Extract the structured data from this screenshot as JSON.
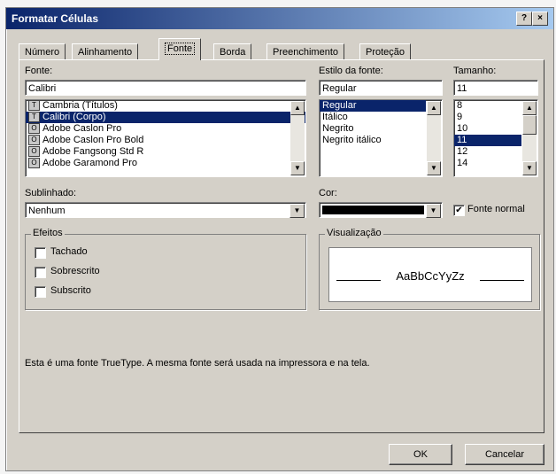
{
  "title": "Formatar Células",
  "title_buttons": {
    "help": "?",
    "close": "×"
  },
  "tabs": [
    {
      "label": "Número"
    },
    {
      "label": "Alinhamento"
    },
    {
      "label": "Fonte"
    },
    {
      "label": "Borda"
    },
    {
      "label": "Preenchimento"
    },
    {
      "label": "Proteção"
    }
  ],
  "active_tab": "Fonte",
  "font": {
    "label": "Fonte:",
    "value": "Calibri",
    "items": [
      "Cambria (Títulos)",
      "Calibri (Corpo)",
      "Adobe Caslon Pro",
      "Adobe Caslon Pro Bold",
      "Adobe Fangsong Std R",
      "Adobe Garamond Pro"
    ],
    "selected": "Calibri (Corpo)"
  },
  "style": {
    "label": "Estilo da fonte:",
    "value": "Regular",
    "items": [
      "Regular",
      "Itálico",
      "Negrito",
      "Negrito itálico"
    ],
    "selected": "Regular"
  },
  "size": {
    "label": "Tamanho:",
    "value": "11",
    "items": [
      "8",
      "9",
      "10",
      "11",
      "12",
      "14"
    ],
    "selected": "11"
  },
  "underline": {
    "label": "Sublinhado:",
    "value": "Nenhum"
  },
  "color": {
    "label": "Cor:",
    "value": "#000000"
  },
  "normal_font": {
    "label": "Fonte normal",
    "checked": true
  },
  "effects": {
    "title": "Efeitos",
    "items": [
      {
        "label": "Tachado",
        "checked": false
      },
      {
        "label": "Sobrescrito",
        "checked": false
      },
      {
        "label": "Subscrito",
        "checked": false
      }
    ]
  },
  "preview": {
    "title": "Visualização",
    "sample": "AaBbCcYyZz"
  },
  "info_text": "Esta é uma fonte TrueType. A mesma fonte será usada na impressora e na tela.",
  "buttons": {
    "ok": "OK",
    "cancel": "Cancelar"
  }
}
